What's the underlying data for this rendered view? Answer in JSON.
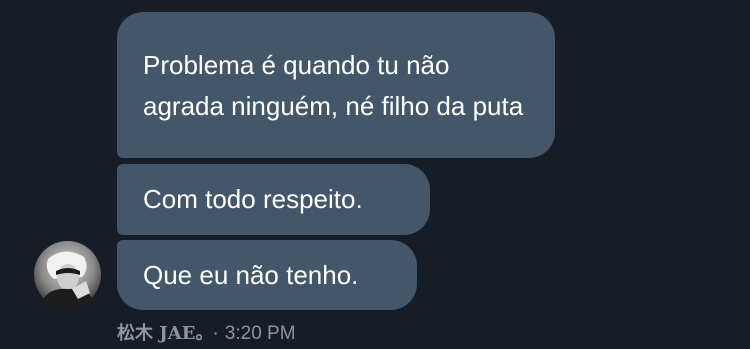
{
  "messages": [
    {
      "text": "Problema é quando tu não agrada ninguém, né filho da puta"
    },
    {
      "text": "Com todo respeito."
    },
    {
      "text": "Que eu não tenho."
    }
  ],
  "sender": {
    "name": "松木 JAE。",
    "avatar_icon": "profile-photo"
  },
  "timestamp": "3:20 PM",
  "separator": "·",
  "colors": {
    "background": "#161d27",
    "bubble": "#44566a",
    "text": "#ffffff",
    "meta_text": "#8a96a3"
  }
}
